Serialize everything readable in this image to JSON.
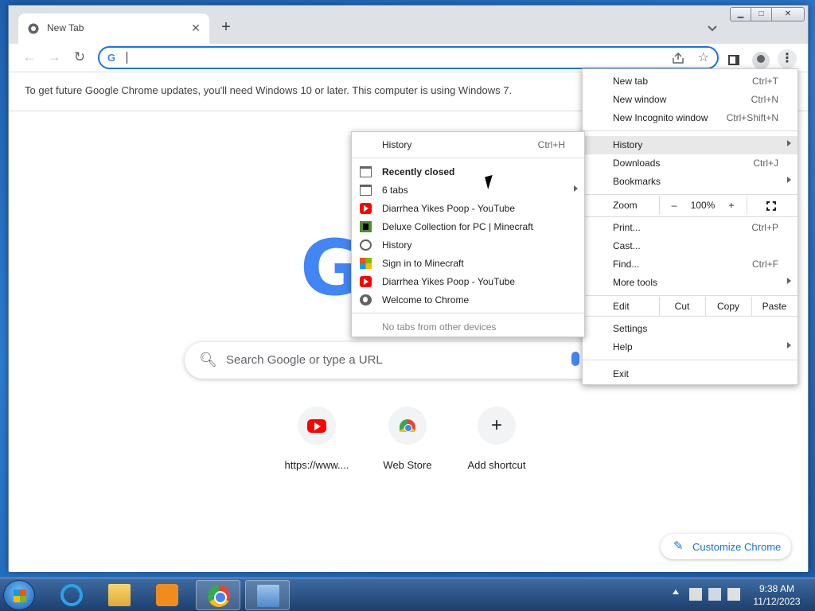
{
  "tab": {
    "title": "New Tab",
    "close": "✕",
    "new_tab": "+"
  },
  "window_controls": {
    "minimize": "▁",
    "maximize": "□",
    "close": "✕"
  },
  "toolbar": {
    "omnibox_logo": "G",
    "omnibox_value": ""
  },
  "infobar": {
    "text": "To get future Google Chrome updates, you'll need Windows 10 or later. This computer is using Windows 7."
  },
  "ntp": {
    "logo": "G",
    "search_placeholder": "Search Google or type a URL",
    "shortcuts": [
      {
        "label": "https://www...."
      },
      {
        "label": "Web Store"
      },
      {
        "label": "Add shortcut"
      }
    ],
    "customize": "Customize Chrome"
  },
  "app_menu": {
    "new_tab": "New tab",
    "new_tab_sc": "Ctrl+T",
    "new_window": "New window",
    "new_window_sc": "Ctrl+N",
    "new_incognito": "New Incognito window",
    "new_incognito_sc": "Ctrl+Shift+N",
    "history": "History",
    "downloads": "Downloads",
    "downloads_sc": "Ctrl+J",
    "bookmarks": "Bookmarks",
    "zoom": "Zoom",
    "zoom_minus": "–",
    "zoom_value": "100%",
    "zoom_plus": "+",
    "print": "Print...",
    "print_sc": "Ctrl+P",
    "cast": "Cast...",
    "find": "Find...",
    "find_sc": "Ctrl+F",
    "more_tools": "More tools",
    "edit": "Edit",
    "cut": "Cut",
    "copy": "Copy",
    "paste": "Paste",
    "settings": "Settings",
    "help": "Help",
    "exit": "Exit"
  },
  "history_menu": {
    "history": "History",
    "history_sc": "Ctrl+H",
    "recently_closed": "Recently closed",
    "items": [
      {
        "label": "6 tabs",
        "icon": "window-icon"
      },
      {
        "label": "Diarrhea Yikes Poop - YouTube",
        "icon": "youtube-icon"
      },
      {
        "label": "Deluxe Collection for PC | Minecraft",
        "icon": "minecraft-icon"
      },
      {
        "label": "History",
        "icon": "history-icon"
      },
      {
        "label": "Sign in to Minecraft",
        "icon": "microsoft-icon"
      },
      {
        "label": "Diarrhea Yikes Poop - YouTube",
        "icon": "youtube-icon"
      },
      {
        "label": "Welcome to Chrome",
        "icon": "globe-icon"
      }
    ],
    "no_tabs": "No tabs from other devices"
  },
  "taskbar": {
    "time": "9:38 AM",
    "date": "11/12/2023"
  }
}
